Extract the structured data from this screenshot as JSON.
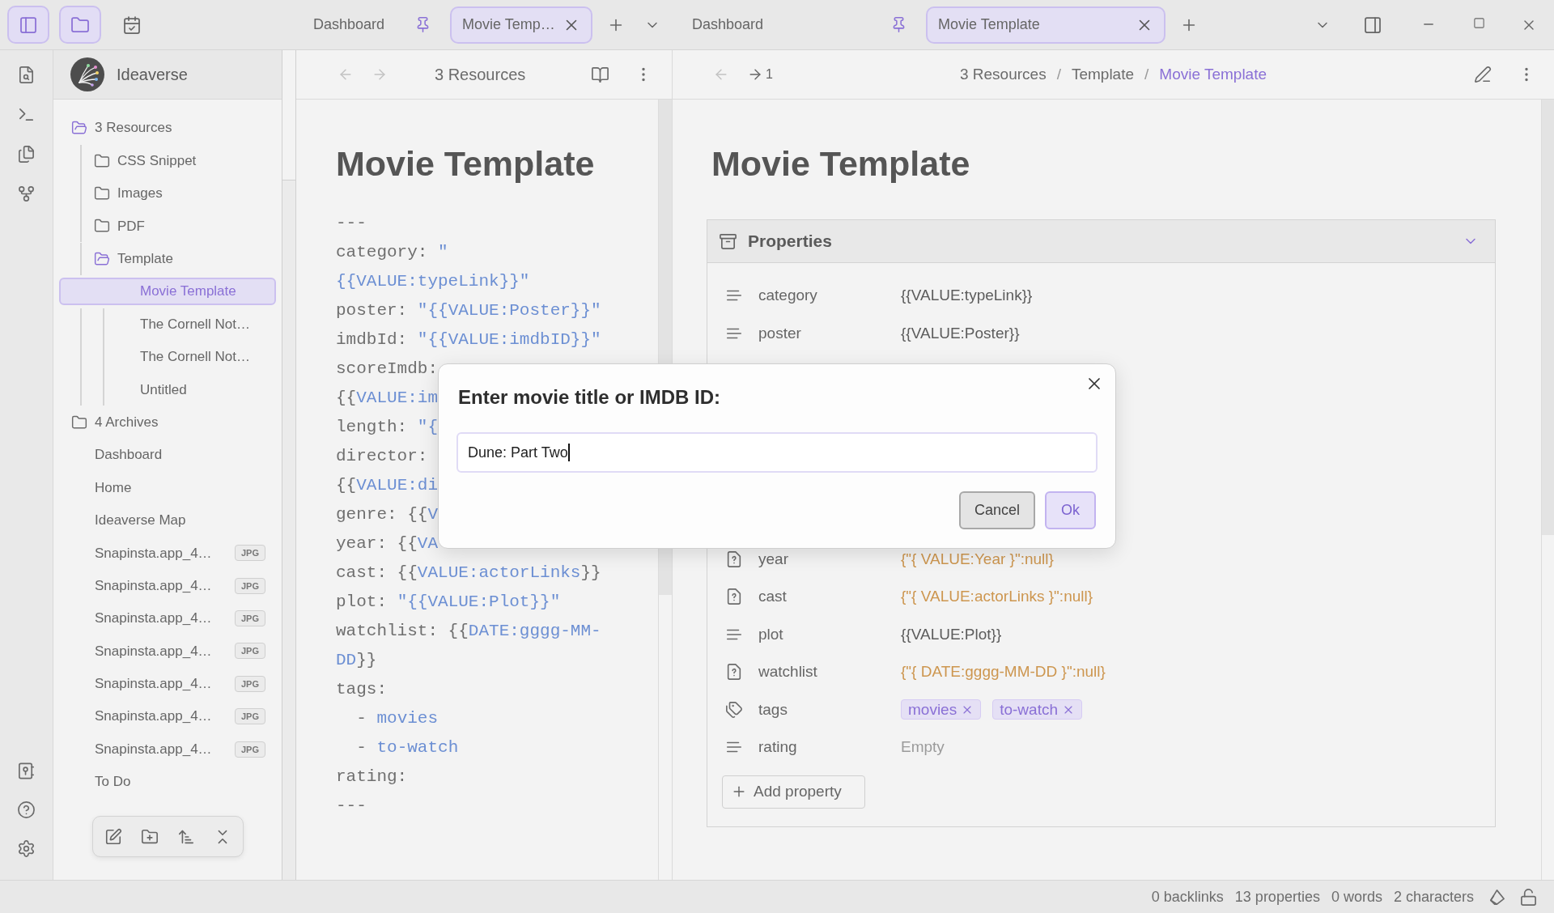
{
  "title_bar": {
    "buttons": [
      {
        "kind": "sidebar",
        "selected": true
      },
      {
        "kind": "files",
        "selected": true
      },
      {
        "kind": "calendar",
        "selected": false
      }
    ],
    "left_tabs": [
      {
        "label": "Dashboard",
        "pinned": true,
        "selected": false
      },
      {
        "label": "Movie Temp…",
        "pinned": false,
        "selected": true
      }
    ],
    "right_tabs": [
      {
        "label": "Dashboard",
        "pinned": true,
        "selected": false
      },
      {
        "label": "Movie Template",
        "pinned": false,
        "selected": true
      }
    ]
  },
  "sidebar": {
    "vault_name": "Ideaverse",
    "tree": [
      {
        "label": "3 Resources",
        "kind": "folder",
        "expanded": true,
        "selected": false,
        "children": [
          {
            "label": "CSS Snippet",
            "kind": "folder",
            "expanded": false,
            "selected": false
          },
          {
            "label": "Images",
            "kind": "folder",
            "expanded": false,
            "selected": false
          },
          {
            "label": "PDF",
            "kind": "folder",
            "expanded": false,
            "selected": false
          },
          {
            "label": "Template",
            "kind": "folder",
            "expanded": true,
            "selected": false,
            "children": [
              {
                "label": "Movie Template",
                "kind": "file",
                "selected": true
              },
              {
                "label": "The Cornell Not…",
                "kind": "file",
                "selected": false
              },
              {
                "label": "The Cornell Not…",
                "kind": "file",
                "selected": false
              },
              {
                "label": "Untitled",
                "kind": "file",
                "selected": false
              }
            ]
          }
        ]
      },
      {
        "label": "4 Archives",
        "kind": "folder",
        "expanded": false,
        "selected": false
      },
      {
        "label": "Dashboard",
        "kind": "file",
        "selected": false
      },
      {
        "label": "Home",
        "kind": "file",
        "selected": false
      },
      {
        "label": "Ideaverse Map",
        "kind": "file",
        "selected": false
      },
      {
        "label": "Snapinsta.app_4…",
        "kind": "file",
        "badge": "JPG",
        "selected": false
      },
      {
        "label": "Snapinsta.app_4…",
        "kind": "file",
        "badge": "JPG",
        "selected": false
      },
      {
        "label": "Snapinsta.app_4…",
        "kind": "file",
        "badge": "JPG",
        "selected": false
      },
      {
        "label": "Snapinsta.app_4…",
        "kind": "file",
        "badge": "JPG",
        "selected": false
      },
      {
        "label": "Snapinsta.app_4…",
        "kind": "file",
        "badge": "JPG",
        "selected": false
      },
      {
        "label": "Snapinsta.app_4…",
        "kind": "file",
        "badge": "JPG",
        "selected": false
      },
      {
        "label": "Snapinsta.app_4…",
        "kind": "file",
        "badge": "JPG",
        "selected": false
      },
      {
        "label": "To Do",
        "kind": "file",
        "selected": false
      }
    ]
  },
  "left_pane": {
    "nav": {
      "back_disabled": true,
      "forward_disabled": true
    },
    "header_title": "3 Resources",
    "note_title": "Movie Template",
    "source_lines": [
      {
        "segments": [
          {
            "kind": "plain",
            "text": "---"
          }
        ]
      },
      {
        "segments": [
          {
            "kind": "plain",
            "text": "category: "
          },
          {
            "kind": "value",
            "text": "\""
          }
        ]
      },
      {
        "segments": [
          {
            "kind": "value",
            "text": "{{VALUE:typeLink}}\""
          }
        ]
      },
      {
        "segments": [
          {
            "kind": "plain",
            "text": "poster: "
          },
          {
            "kind": "value",
            "text": "\"{{VALUE:Poster}}\""
          }
        ]
      },
      {
        "segments": [
          {
            "kind": "plain",
            "text": "imdbId: "
          },
          {
            "kind": "value",
            "text": "\"{{VALUE:imdbID}}\""
          }
        ]
      },
      {
        "segments": [
          {
            "kind": "plain",
            "text": "scoreImdb:"
          }
        ]
      },
      {
        "segments": [
          {
            "kind": "plain",
            "text": "{{"
          },
          {
            "kind": "value",
            "text": "VALUE:im"
          }
        ]
      },
      {
        "segments": [
          {
            "kind": "plain",
            "text": "length: "
          },
          {
            "kind": "value",
            "text": "\"{"
          }
        ]
      },
      {
        "segments": [
          {
            "kind": "plain",
            "text": "director:"
          }
        ]
      },
      {
        "segments": [
          {
            "kind": "plain",
            "text": "{{"
          },
          {
            "kind": "value",
            "text": "VALUE:di"
          }
        ]
      },
      {
        "segments": [
          {
            "kind": "plain",
            "text": "genre: {{"
          },
          {
            "kind": "value",
            "text": "V"
          }
        ]
      },
      {
        "segments": [
          {
            "kind": "plain",
            "text": "year: {{"
          },
          {
            "kind": "value",
            "text": "VA"
          }
        ]
      },
      {
        "segments": [
          {
            "kind": "plain",
            "text": "cast: {{"
          },
          {
            "kind": "value",
            "text": "VALUE:actorLinks"
          },
          {
            "kind": "plain",
            "text": "}}"
          }
        ]
      },
      {
        "segments": [
          {
            "kind": "plain",
            "text": "plot: "
          },
          {
            "kind": "value",
            "text": "\"{{VALUE:Plot}}\""
          }
        ]
      },
      {
        "segments": [
          {
            "kind": "plain",
            "text": "watchlist: {{"
          },
          {
            "kind": "value",
            "text": "DATE:gggg-MM-"
          }
        ]
      },
      {
        "segments": [
          {
            "kind": "value",
            "text": "DD"
          },
          {
            "kind": "plain",
            "text": "}}"
          }
        ]
      },
      {
        "segments": [
          {
            "kind": "plain",
            "text": "tags:"
          }
        ]
      },
      {
        "segments": [
          {
            "kind": "plain",
            "text": "  - "
          },
          {
            "kind": "value",
            "text": "movies"
          }
        ]
      },
      {
        "segments": [
          {
            "kind": "plain",
            "text": "  - "
          },
          {
            "kind": "value",
            "text": "to-watch"
          }
        ]
      },
      {
        "segments": [
          {
            "kind": "plain",
            "text": "rating:"
          }
        ]
      },
      {
        "segments": [
          {
            "kind": "plain",
            "text": "---"
          }
        ]
      }
    ]
  },
  "right_pane": {
    "nav": {
      "back_disabled": true,
      "forward_disabled": false,
      "forward_label": "1"
    },
    "breadcrumb": [
      {
        "kind": "folder",
        "text": "3 Resources"
      },
      {
        "kind": "separator",
        "text": "/"
      },
      {
        "kind": "folder",
        "text": "Template"
      },
      {
        "kind": "separator",
        "text": "/"
      },
      {
        "kind": "current",
        "text": "Movie Template"
      }
    ],
    "note_title": "Movie Template",
    "properties": {
      "title": "Properties",
      "expanded": true,
      "rows_above_dialog": [
        {
          "name": "category",
          "kind": "text",
          "value": "{{VALUE:typeLink}}"
        },
        {
          "name": "poster",
          "kind": "text",
          "value": "{{VALUE:Poster}}"
        }
      ],
      "rows_below_dialog": [
        {
          "name": "year",
          "kind": "unknown",
          "value": "{\"{ VALUE:Year }\":null}"
        },
        {
          "name": "cast",
          "kind": "unknown",
          "value": "{\"{ VALUE:actorLinks }\":null}"
        },
        {
          "name": "plot",
          "kind": "text",
          "value": "{{VALUE:Plot}}"
        },
        {
          "name": "watchlist",
          "kind": "unknown",
          "value": "{\"{ DATE:gggg-MM-DD }\":null}"
        },
        {
          "name": "tags",
          "kind": "tags",
          "tags": [
            "movies",
            "to-watch"
          ]
        },
        {
          "name": "rating",
          "kind": "text",
          "placeholder": "Empty"
        }
      ],
      "add_button": "Add property"
    }
  },
  "dialog": {
    "title": "Enter movie title or IMDB ID:",
    "value": "Dune: Part Two",
    "buttons": [
      {
        "label": "Cancel",
        "kind": "secondary"
      },
      {
        "label": "Ok",
        "kind": "primary"
      }
    ]
  },
  "status_bar": {
    "items": [
      "0 backlinks",
      "13 properties",
      "0 words",
      "2 characters"
    ]
  }
}
